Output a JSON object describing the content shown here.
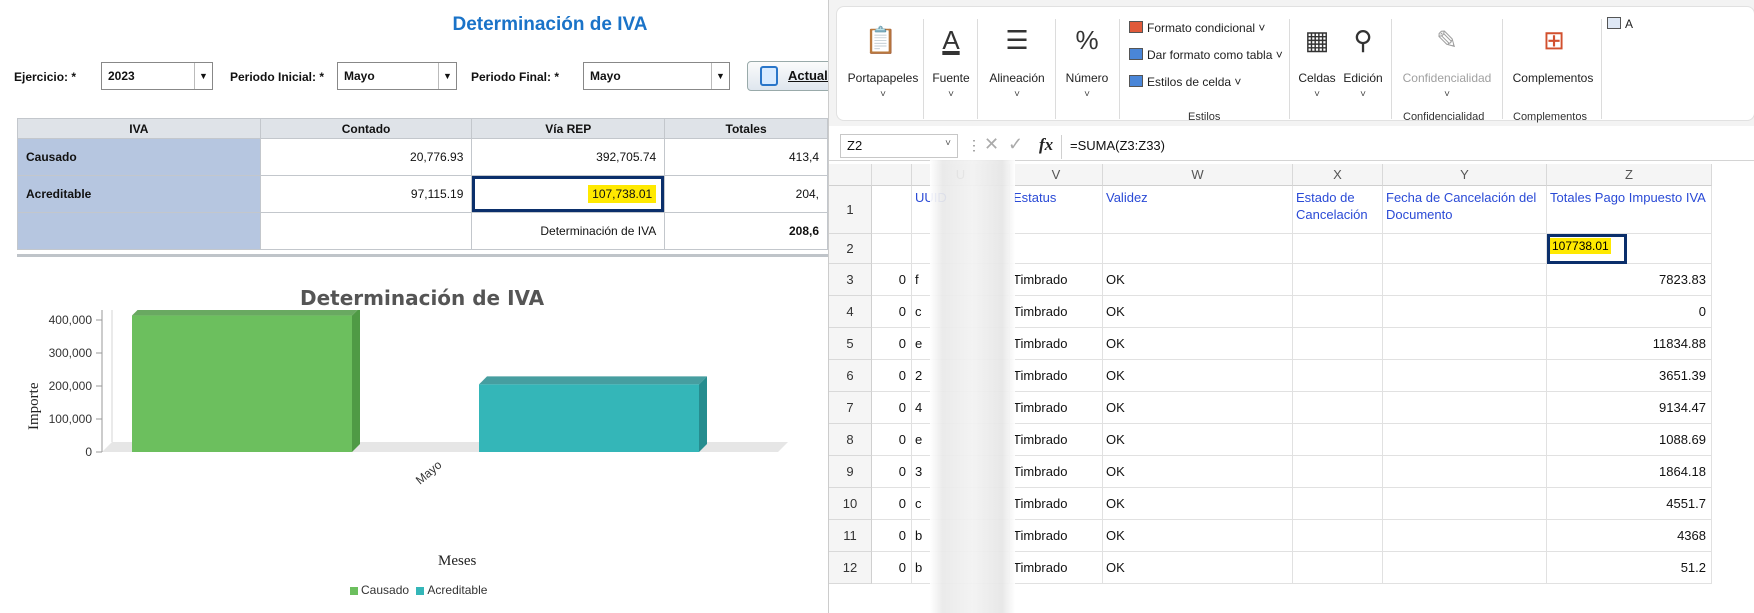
{
  "left": {
    "title": "Determinación de IVA",
    "filters": {
      "ejercicio_label": "Ejercicio: *",
      "ejercicio_value": "2023",
      "periodo_inicial_label": "Periodo Inicial: *",
      "periodo_inicial_value": "Mayo",
      "periodo_final_label": "Periodo Final: *",
      "periodo_final_value": "Mayo",
      "actualizar_label": "Actuali"
    },
    "table": {
      "headers": [
        "IVA",
        "Contado",
        "Vía REP",
        "Totales"
      ],
      "rows": [
        {
          "label": "Causado",
          "contado": "20,776.93",
          "via_rep": "392,705.74",
          "totales": "413,4"
        },
        {
          "label": "Acreditable",
          "contado": "97,115.19",
          "via_rep": "107,738.01",
          "totales": "204,"
        },
        {
          "label": "",
          "contado": "",
          "via_rep": "Determinación de IVA",
          "totales": "208,6"
        }
      ]
    }
  },
  "chart_data": {
    "type": "bar",
    "title": "Determinación de IVA",
    "xlabel": "Meses",
    "ylabel": "Importe",
    "categories": [
      "Mayo"
    ],
    "series": [
      {
        "name": "Causado",
        "values": [
          413482.67
        ],
        "color": "#6cbf5e"
      },
      {
        "name": "Acreditable",
        "values": [
          204853.2
        ],
        "color": "#34b6b8"
      }
    ],
    "yticks": [
      "400,000",
      "300,000",
      "200,000",
      "100,000",
      "0"
    ],
    "ylim": [
      0,
      450000
    ],
    "grid": false,
    "legend": "bottom"
  },
  "excel": {
    "ribbon": {
      "portapapeles": "Portapapeles",
      "fuente": "Fuente",
      "alineacion": "Alineación",
      "numero": "Número",
      "formato_condicional": "Formato condicional ˅",
      "dar_formato": "Dar formato como tabla ˅",
      "estilos_celda": "Estilos de celda ˅",
      "estilos_group": "Estilos",
      "celdas": "Celdas",
      "edicion": "Edición",
      "confidencialidad": "Confidencialidad",
      "confidencialidad_group": "Confidencialidad",
      "complementos": "Complementos",
      "complementos_group": "Complementos",
      "edge_label": "A"
    },
    "namebox": "Z2",
    "formula": "=SUMA(Z3:Z33)",
    "fx": "fx",
    "columns": [
      "U",
      "V",
      "W",
      "X",
      "Y",
      "Z"
    ],
    "header_row": {
      "u": "UUID",
      "v": "Estatus",
      "w": "Validez",
      "x": "Estado de Cancelación",
      "y": "Fecha de Cancelación del Documento",
      "z": "Totales Pago Impuesto IVA"
    },
    "z2_value": "107738.01",
    "rows": [
      {
        "n": "3",
        "t": "0",
        "u": "f",
        "v": "Timbrado",
        "w": "OK",
        "z": "7823.83"
      },
      {
        "n": "4",
        "t": "0",
        "u": "c",
        "v": "Timbrado",
        "w": "OK",
        "z": "0"
      },
      {
        "n": "5",
        "t": "0",
        "u": "e",
        "v": "Timbrado",
        "w": "OK",
        "z": "11834.88"
      },
      {
        "n": "6",
        "t": "0",
        "u": "2",
        "v": "Timbrado",
        "w": "OK",
        "z": "3651.39"
      },
      {
        "n": "7",
        "t": "0",
        "u": "4",
        "v": "Timbrado",
        "w": "OK",
        "z": "9134.47"
      },
      {
        "n": "8",
        "t": "0",
        "u": "e",
        "v": "Timbrado",
        "w": "OK",
        "z": "1088.69"
      },
      {
        "n": "9",
        "t": "0",
        "u": "3",
        "v": "Timbrado",
        "w": "OK",
        "z": "1864.18"
      },
      {
        "n": "10",
        "t": "0",
        "u": "c",
        "v": "Timbrado",
        "w": "OK",
        "z": "4551.7"
      },
      {
        "n": "11",
        "t": "0",
        "u": "b",
        "v": "Timbrado",
        "w": "OK",
        "z": "4368"
      },
      {
        "n": "12",
        "t": "0",
        "u": "b",
        "v": "Timbrado",
        "w": "OK",
        "z": "51.2"
      }
    ]
  }
}
